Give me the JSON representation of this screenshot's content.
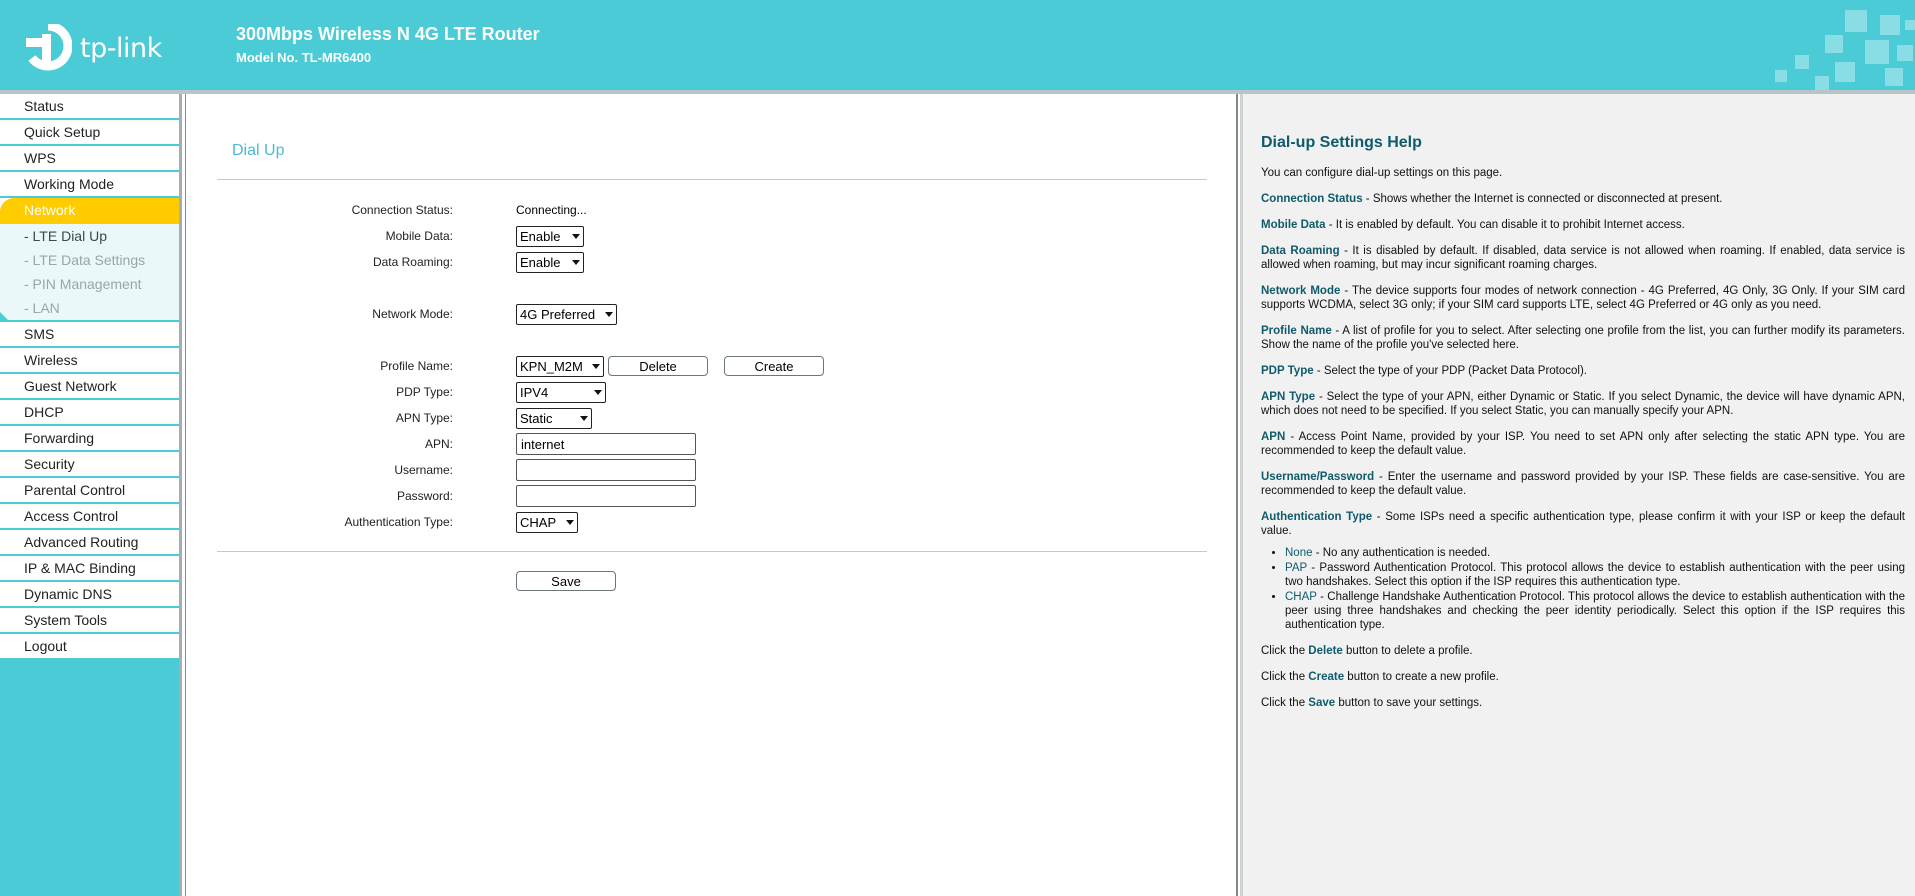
{
  "header": {
    "brand": "tp-link",
    "product_title": "300Mbps Wireless N 4G LTE Router",
    "model_no": "Model No. TL-MR6400"
  },
  "sidebar": {
    "items_top": [
      {
        "label": "Status"
      },
      {
        "label": "Quick Setup"
      },
      {
        "label": "WPS"
      },
      {
        "label": "Working Mode"
      },
      {
        "label": "Network"
      }
    ],
    "subitems": [
      {
        "label": "- LTE Dial Up"
      },
      {
        "label": "- LTE Data Settings"
      },
      {
        "label": "- PIN Management"
      },
      {
        "label": "- LAN"
      }
    ],
    "items_bottom": [
      {
        "label": "SMS"
      },
      {
        "label": "Wireless"
      },
      {
        "label": "Guest Network"
      },
      {
        "label": "DHCP"
      },
      {
        "label": "Forwarding"
      },
      {
        "label": "Security"
      },
      {
        "label": "Parental Control"
      },
      {
        "label": "Access Control"
      },
      {
        "label": "Advanced Routing"
      },
      {
        "label": "IP & MAC Binding"
      },
      {
        "label": "Dynamic DNS"
      },
      {
        "label": "System Tools"
      },
      {
        "label": "Logout"
      }
    ]
  },
  "main": {
    "title": "Dial Up",
    "connection_status": {
      "label": "Connection Status:",
      "value": "Connecting..."
    },
    "mobile_data": {
      "label": "Mobile Data:",
      "value": "Enable"
    },
    "data_roaming": {
      "label": "Data Roaming:",
      "value": "Enable"
    },
    "network_mode": {
      "label": "Network Mode:",
      "value": "4G Preferred"
    },
    "profile_name": {
      "label": "Profile Name:",
      "value": "KPN_M2M",
      "delete_label": "Delete",
      "create_label": "Create"
    },
    "pdp_type": {
      "label": "PDP Type:",
      "value": "IPV4"
    },
    "apn_type": {
      "label": "APN Type:",
      "value": "Static"
    },
    "apn": {
      "label": "APN:",
      "value": "internet"
    },
    "username": {
      "label": "Username:",
      "value": ""
    },
    "password": {
      "label": "Password:",
      "value": ""
    },
    "auth_type": {
      "label": "Authentication Type:",
      "value": "CHAP"
    },
    "save_label": "Save"
  },
  "help": {
    "title": "Dial-up Settings Help",
    "intro": "You can configure dial-up settings on this page.",
    "sections": [
      {
        "term": "Connection Status",
        "text": " - Shows whether the Internet is connected or disconnected at present."
      },
      {
        "term": "Mobile Data",
        "text": " - It is enabled by default. You can disable it to prohibit Internet access."
      },
      {
        "term": "Data Roaming",
        "text": " - It is disabled by default. If disabled, data service is not allowed when roaming. If enabled, data service is allowed when roaming, but may incur significant roaming charges."
      },
      {
        "term": "Network Mode",
        "text": " - The device supports four modes of network connection - 4G Preferred, 4G Only, 3G Only. If your SIM card supports WCDMA, select 3G only; if your SIM card supports LTE, select 4G Preferred or 4G only as you need."
      },
      {
        "term": "Profile Name",
        "text": " - A list of profile for you to select. After selecting one profile from the list, you can further modify its parameters. Show the name of the profile you've selected here."
      },
      {
        "term": "PDP Type",
        "text": " - Select the type of your PDP (Packet Data Protocol)."
      },
      {
        "term": "APN Type",
        "text": " - Select the type of your APN, either Dynamic or Static. If you select Dynamic, the device will have dynamic APN, which does not need to be specified. If you select Static, you can manually specify your APN."
      },
      {
        "term": "APN",
        "text": " - Access Point Name, provided by your ISP. You need to set APN only after selecting the static APN type. You are recommended to keep the default value."
      },
      {
        "term": "Username/Password",
        "text": " - Enter the username and password provided by your ISP. These fields are case-sensitive. You are recommended to keep the default value."
      },
      {
        "term": "Authentication Type",
        "text": " - Some ISPs need a specific authentication type, please confirm it with your ISP or keep the default value."
      }
    ],
    "auth_list": [
      {
        "term": "None",
        "text": " - No any authentication is needed."
      },
      {
        "term": "PAP",
        "text": " - Password Authentication Protocol. This protocol allows the device to establish authentication with the peer using two handshakes. Select this option if the ISP requires this authentication type."
      },
      {
        "term": "CHAP",
        "text": " - Challenge Handshake Authentication Protocol. This protocol allows the device to establish authentication with the peer using three handshakes and checking the peer identity periodically. Select this option if the ISP requires this authentication type."
      }
    ],
    "clicks": [
      {
        "pre": "Click the ",
        "term": "Delete",
        "post": " button to delete a profile."
      },
      {
        "pre": "Click the ",
        "term": "Create",
        "post": " button to create a new profile."
      },
      {
        "pre": "Click the ",
        "term": "Save",
        "post": " button to save your settings."
      }
    ]
  },
  "colors": {
    "brand_teal": "#4acbd6",
    "active_menu": "#ffcc00",
    "help_term": "#0f5a6b",
    "page_title": "#4abbd0"
  }
}
